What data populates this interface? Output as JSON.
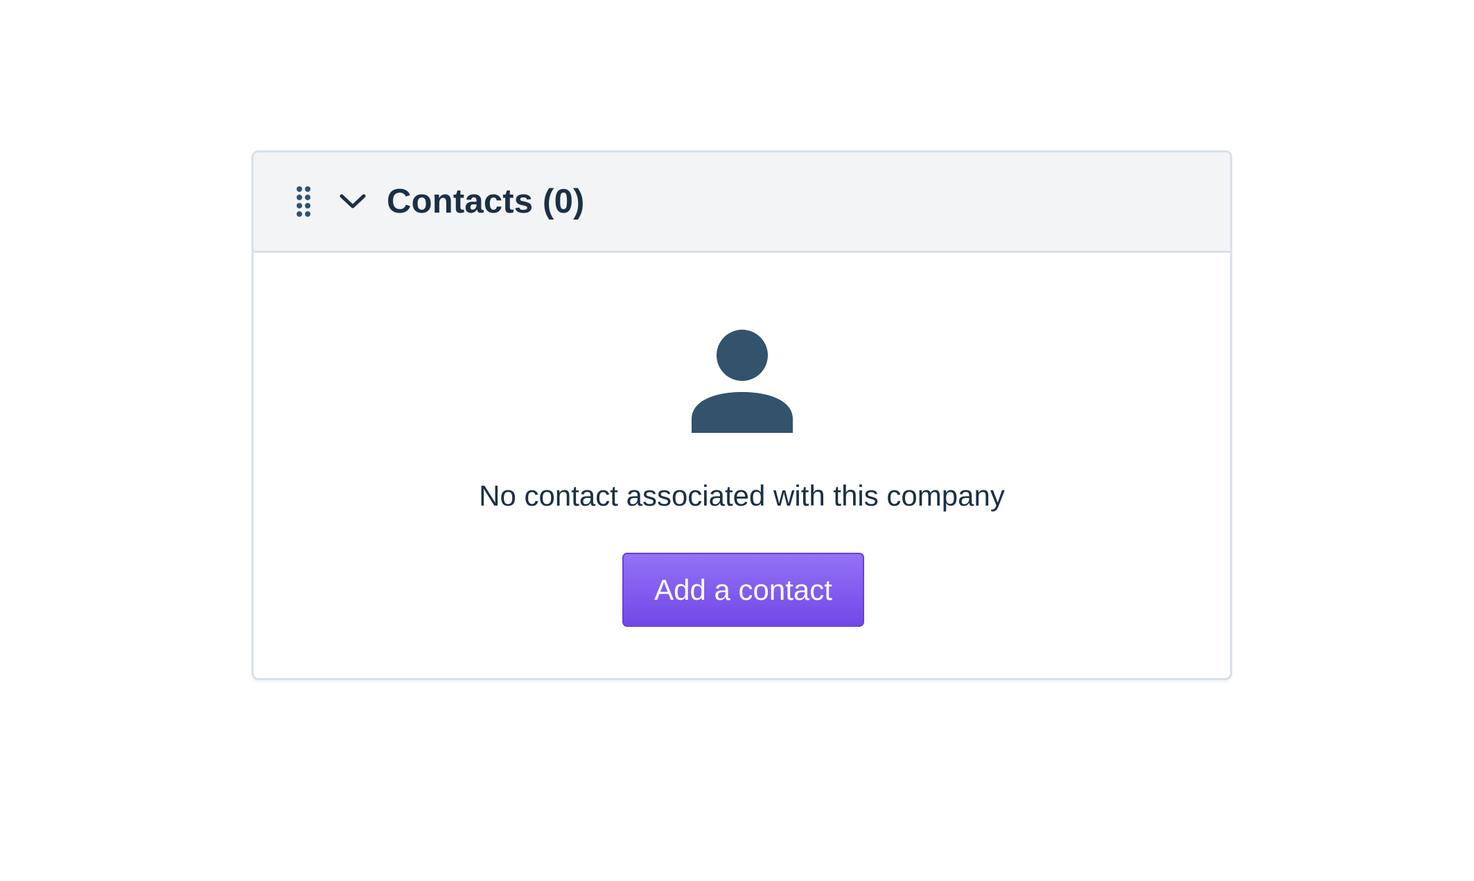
{
  "contacts_panel": {
    "title": "Contacts (0)",
    "empty_state": {
      "icon": "person-icon",
      "message": "No contact associated with this company"
    },
    "add_button_label": "Add a contact",
    "drag_handle_icon": "drag-handle-icon",
    "collapse_icon": "chevron-down-icon"
  },
  "colors": {
    "text": "#1c2f45",
    "icon": "#33526b",
    "header_background": "#f2f4f6",
    "border": "#d9e1e8",
    "button_top": "#9372f8",
    "button_bottom": "#7148e6",
    "button_text": "#ffffff"
  }
}
